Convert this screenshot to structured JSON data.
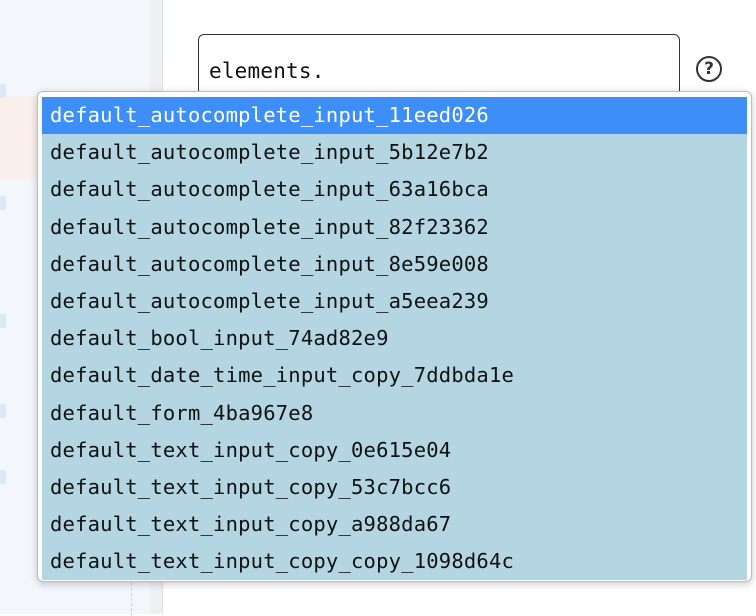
{
  "editor": {
    "code_value": "elements."
  },
  "help": {
    "icon_glyph": "?",
    "icon_name": "help-circle-icon"
  },
  "autocomplete": {
    "selected_index": 0,
    "colors": {
      "item_bg": "#b3d6e2",
      "selected_bg": "#3d8ff7",
      "selected_text": "#ffffff"
    },
    "items": [
      "default_autocomplete_input_11eed026",
      "default_autocomplete_input_5b12e7b2",
      "default_autocomplete_input_63a16bca",
      "default_autocomplete_input_82f23362",
      "default_autocomplete_input_8e59e008",
      "default_autocomplete_input_a5eea239",
      "default_bool_input_74ad82e9",
      "default_date_time_input_copy_7ddbda1e",
      "default_form_4ba967e8",
      "default_text_input_copy_0e615e04",
      "default_text_input_copy_53c7bcc6",
      "default_text_input_copy_a988da67",
      "default_text_input_copy_copy_1098d64c"
    ]
  }
}
